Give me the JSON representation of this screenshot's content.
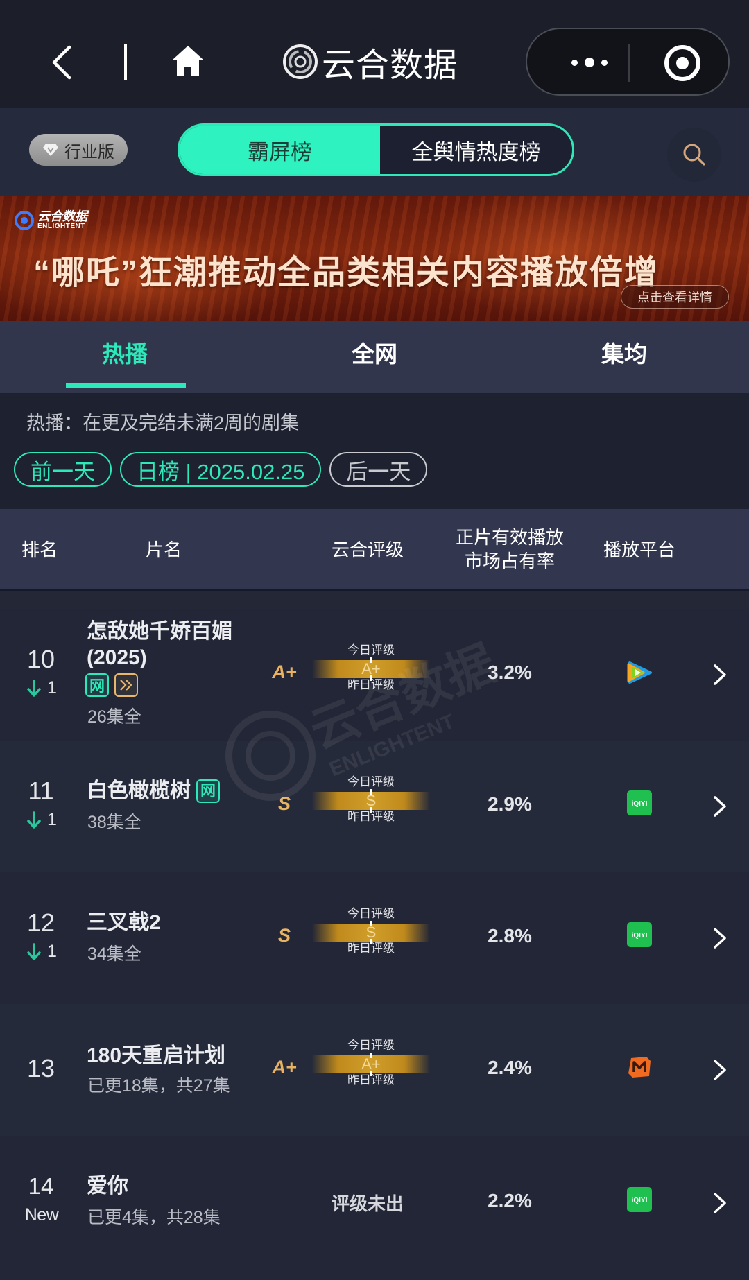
{
  "nav": {
    "back_icon": "chevron-left-icon",
    "home_icon": "home-icon",
    "app_title": "云合数据",
    "logo_icon": "yunhe-logo-icon",
    "more_icon": "more-dots-icon",
    "target_icon": "target-circle-icon"
  },
  "subheader": {
    "edition_label": "行业版",
    "segments": [
      {
        "label": "霸屏榜",
        "active": true
      },
      {
        "label": "全舆情热度榜",
        "active": false
      }
    ],
    "search_icon": "search-icon"
  },
  "banner": {
    "brand_cn": "云合数据",
    "brand_en": "ENLIGHTENT",
    "headline": "“哪吒”狂潮推动全品类相关内容播放倍增",
    "detail_button": "点击查看详情"
  },
  "tabs": [
    {
      "label": "热播",
      "active": true
    },
    {
      "label": "全网",
      "active": false
    },
    {
      "label": "集均",
      "active": false
    }
  ],
  "description": "热播：在更及完结未满2周的剧集",
  "date_nav": {
    "prev_label": "前一天",
    "current_label": "日榜 | 2025.02.25",
    "next_label": "后一天"
  },
  "table": {
    "headers": {
      "rank": "排名",
      "title": "片名",
      "grade": "云合评级",
      "share_line1": "正片有效播放",
      "share_line2": "市场占有率",
      "platform": "播放平台"
    },
    "grade_today_label": "今日评级",
    "grade_yesterday_label": "昨日评级",
    "rows": [
      {
        "rank": "10",
        "change_dir": "down",
        "change": "1",
        "title_line1": "怎敌她千娇百媚",
        "title_line2": "(2025)",
        "badges": [
          "网",
          "»"
        ],
        "episodes": "26集全",
        "grade_today": "A+",
        "grade_bar": "A+",
        "share": "3.2%",
        "platform": "tencent-video-icon"
      },
      {
        "rank": "11",
        "change_dir": "down",
        "change": "1",
        "title_line1": "白色橄榄树",
        "badges": [
          "网"
        ],
        "episodes": "38集全",
        "grade_today": "S",
        "grade_bar": "S",
        "share": "2.9%",
        "platform": "iqiyi-icon"
      },
      {
        "rank": "12",
        "change_dir": "down",
        "change": "1",
        "title_line1": "三叉戟2",
        "episodes": "34集全",
        "grade_today": "S",
        "grade_bar": "S",
        "share": "2.8%",
        "platform": "iqiyi-icon"
      },
      {
        "rank": "13",
        "title_line1": "180天重启计划",
        "episodes": "已更18集，共27集",
        "grade_today": "A+",
        "grade_bar": "A+",
        "share": "2.4%",
        "platform": "mango-tv-icon"
      },
      {
        "rank": "14",
        "change_label": "New",
        "title_line1": "爱你",
        "episodes": "已更4集，共28集",
        "grade_pending": "评级未出",
        "share": "2.2%",
        "platform": "iqiyi-icon"
      }
    ]
  },
  "platform_labels": {
    "iqiyi": "iQIYI"
  },
  "colors": {
    "accent": "#2de8b8",
    "grade_gold": "#e8b263",
    "background": "#1e2230"
  }
}
